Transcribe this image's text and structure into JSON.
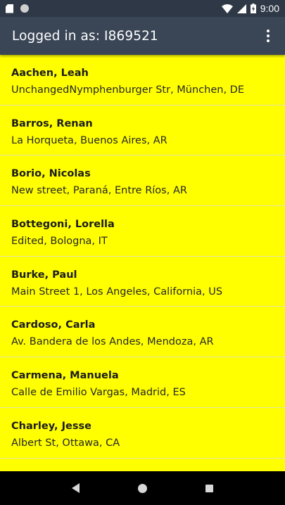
{
  "status_bar": {
    "time": "9:00",
    "icons": [
      "sd-card-icon",
      "sync-dot-icon",
      "wifi-icon",
      "cell-signal-icon",
      "battery-charging-icon"
    ]
  },
  "app_bar": {
    "title": "Logged in as: I869521",
    "menu_icon": "overflow-menu-icon"
  },
  "list": {
    "background_color": "#ffff00",
    "items": [
      {
        "name": "Aachen, Leah",
        "address": "UnchangedNymphenburger Str, München, DE"
      },
      {
        "name": "Barros, Renan",
        "address": "La Horqueta, Buenos Aires, AR"
      },
      {
        "name": "Borio, Nicolas",
        "address": "New street, Paraná, Entre Ríos, AR"
      },
      {
        "name": "Bottegoni, Lorella",
        "address": "Edited, Bologna, IT"
      },
      {
        "name": "Burke, Paul",
        "address": "Main Street 1, Los Angeles, California, US"
      },
      {
        "name": "Cardoso, Carla",
        "address": "Av. Bandera de los Andes, Mendoza, AR"
      },
      {
        "name": "Carmena, Manuela",
        "address": "Calle de Emilio Vargas, Madrid, ES"
      },
      {
        "name": "Charley, Jesse",
        "address": "Albert St, Ottawa, CA"
      },
      {
        "name": "",
        "address": ""
      }
    ]
  },
  "nav_bar": {
    "icons": [
      "back-icon",
      "home-icon",
      "recents-icon"
    ]
  }
}
